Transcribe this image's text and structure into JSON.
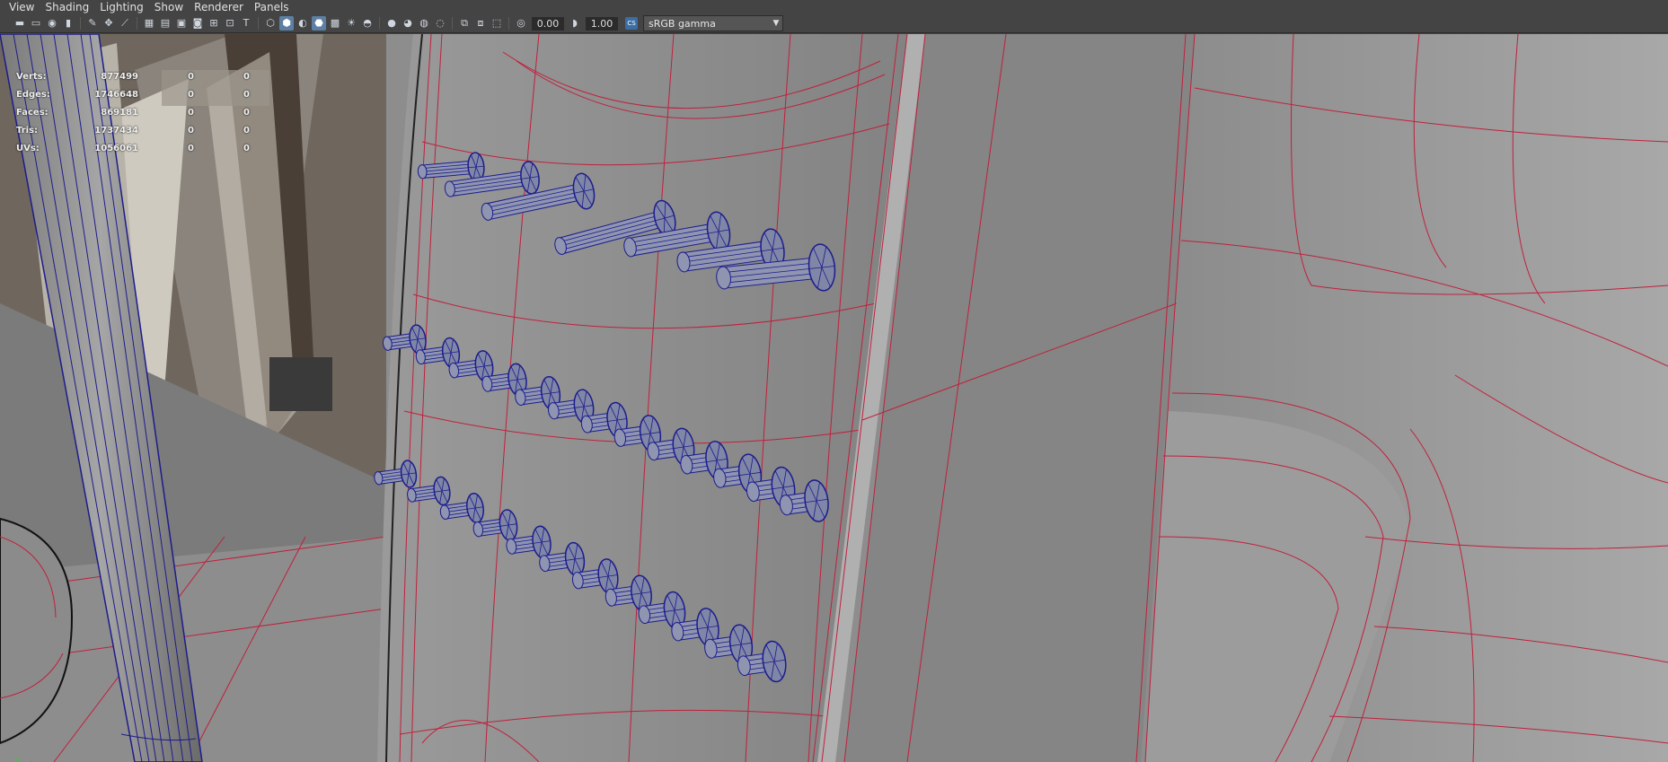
{
  "menu": [
    "View",
    "Shading",
    "Lighting",
    "Show",
    "Renderer",
    "Panels"
  ],
  "toolbar": {
    "exposure": "0.00",
    "gamma": "1.00",
    "color_space": "sRGB gamma",
    "color_space_badge": "CS",
    "icons": [
      "camera-icon",
      "camera-attr-icon",
      "bookmark-icon",
      "image-plane-icon",
      "grease-pencil-icon",
      "twod-pan-icon",
      "grid-icon",
      "film-gate-icon",
      "resolution-gate-icon",
      "gate-mask-icon",
      "field-chart-icon",
      "safe-action-icon",
      "safe-title-icon",
      "wireframe-icon",
      "smooth-shade-icon",
      "default-material-icon",
      "wireframe-on-shaded-icon",
      "xray-icon",
      "xray-joints-icon",
      "use-all-lights-icon",
      "shadows-icon",
      "screen-ambient-occlusion-icon",
      "motion-blur-icon",
      "multisample-aa-icon",
      "depth-of-field-icon",
      "isolate-select-icon",
      "xray-active-icon",
      "heads-up-icon",
      "textured-icon"
    ]
  },
  "hud": {
    "rows": [
      {
        "label": "Verts:",
        "v1": "877499",
        "v2": "0",
        "v3": "0"
      },
      {
        "label": "Edges:",
        "v1": "1746648",
        "v2": "0",
        "v3": "0"
      },
      {
        "label": "Faces:",
        "v1": "869181",
        "v2": "0",
        "v3": "0"
      },
      {
        "label": "Tris:",
        "v1": "1737434",
        "v2": "0",
        "v3": "0"
      },
      {
        "label": "UVs:",
        "v1": "1056061",
        "v2": "0",
        "v3": "0"
      }
    ]
  },
  "viewport": {
    "camera": "persp",
    "axis": {
      "x": "x",
      "y": "y",
      "z": "z"
    },
    "colors": {
      "wire": "#c0203c",
      "selected": "#1c1c8c",
      "surface": "#8e8e8e",
      "background": "#444444"
    }
  }
}
